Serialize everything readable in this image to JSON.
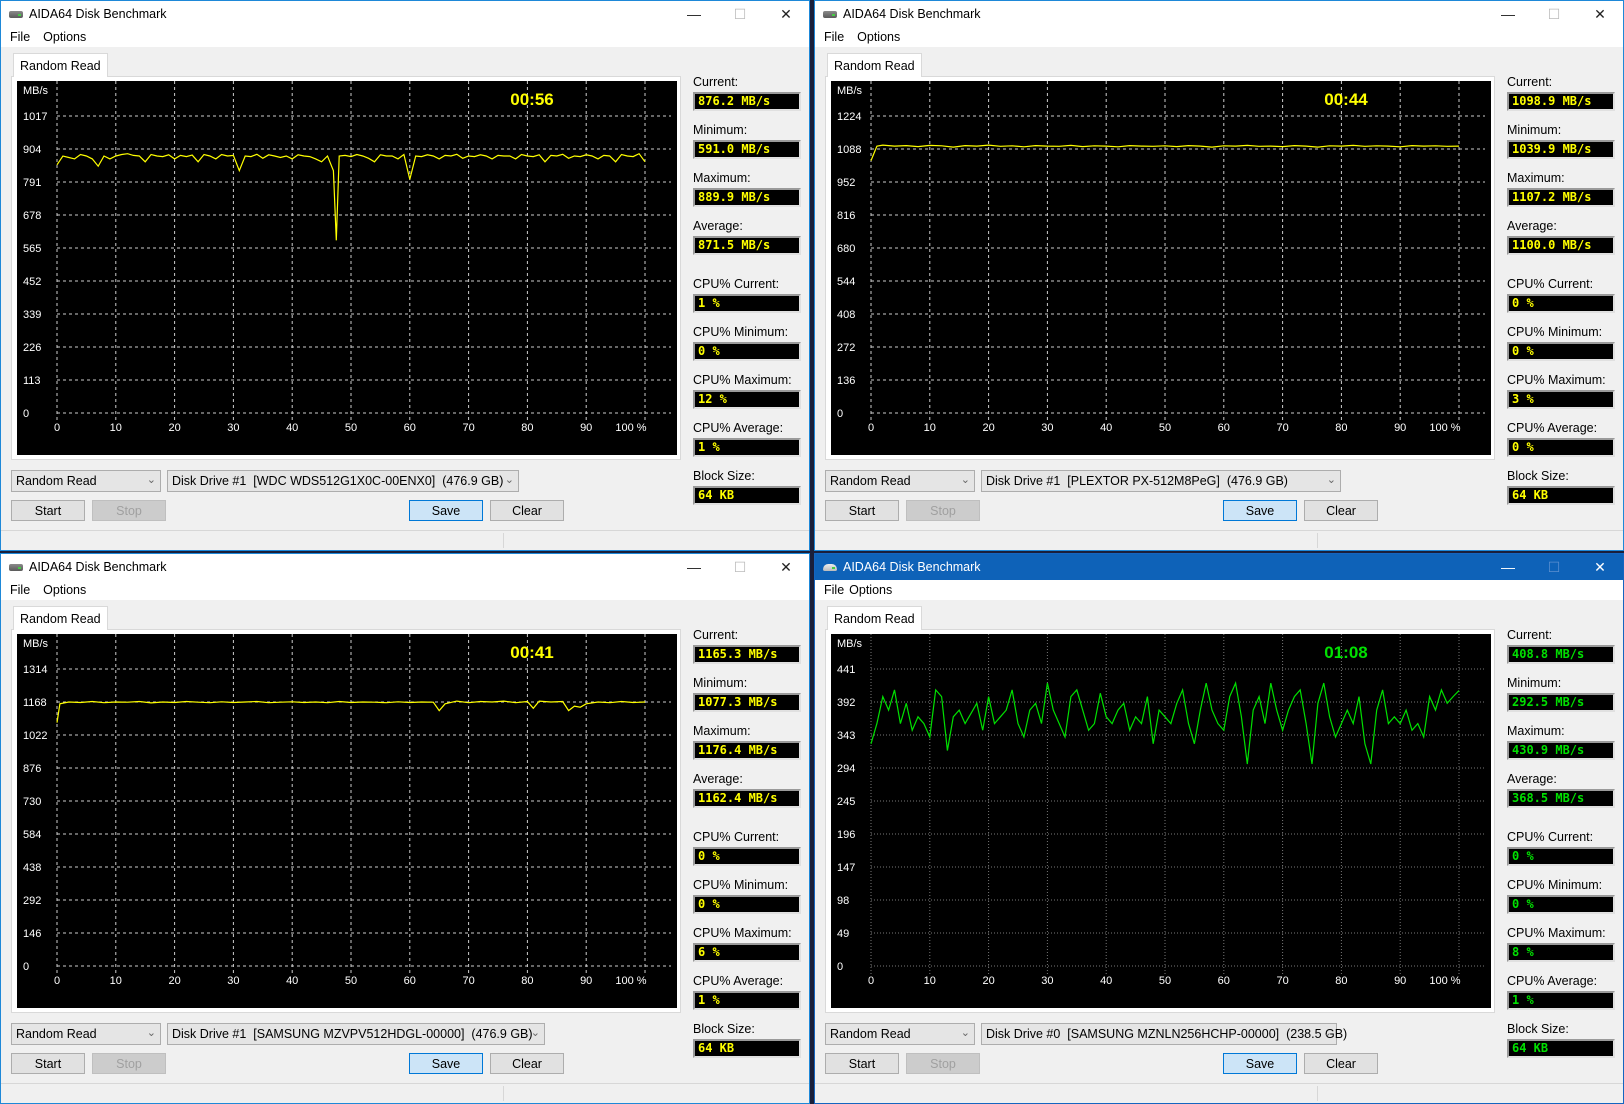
{
  "app_title": "AIDA64 Disk Benchmark",
  "menu": [
    "File",
    "Options"
  ],
  "window_controls": {
    "minimize": "—",
    "maximize": "☐",
    "close": "✕"
  },
  "labels": {
    "tab": "Random Read",
    "current": "Current:",
    "minimum": "Minimum:",
    "maximum": "Maximum:",
    "average": "Average:",
    "cpu_current": "CPU% Current:",
    "cpu_minimum": "CPU% Minimum:",
    "cpu_maximum": "CPU% Maximum:",
    "cpu_average": "CPU% Average:",
    "block_size": "Block Size:",
    "start": "Start",
    "stop": "Stop",
    "save": "Save",
    "clear": "Clear",
    "test_select": "Random Read",
    "y_unit": "MB/s"
  },
  "windows": [
    {
      "active": false,
      "timer": "00:56",
      "drive": "Disk Drive #1  [WDC WDS512G1X0C-00ENX0]  (476.9 GB)",
      "stats": {
        "current": "876.2 MB/s",
        "minimum": "591.0 MB/s",
        "maximum": "889.9 MB/s",
        "average": "871.5 MB/s",
        "cpu_current": "1 %",
        "cpu_minimum": "0 %",
        "cpu_maximum": "12 %",
        "cpu_average": "1 %",
        "block_size": "64 KB"
      },
      "line_color": "#ffff00"
    },
    {
      "active": false,
      "timer": "00:44",
      "drive": "Disk Drive #1  [PLEXTOR PX-512M8PeG]  (476.9 GB)",
      "stats": {
        "current": "1098.9 MB/s",
        "minimum": "1039.9 MB/s",
        "maximum": "1107.2 MB/s",
        "average": "1100.0 MB/s",
        "cpu_current": "0 %",
        "cpu_minimum": "0 %",
        "cpu_maximum": "3 %",
        "cpu_average": "0 %",
        "block_size": "64 KB"
      },
      "line_color": "#ffff00"
    },
    {
      "active": false,
      "timer": "00:41",
      "drive": "Disk Drive #1  [SAMSUNG MZVPV512HDGL-00000]  (476.9 GB)",
      "stats": {
        "current": "1165.3 MB/s",
        "minimum": "1077.3 MB/s",
        "maximum": "1176.4 MB/s",
        "average": "1162.4 MB/s",
        "cpu_current": "0 %",
        "cpu_minimum": "0 %",
        "cpu_maximum": "6 %",
        "cpu_average": "1 %",
        "block_size": "64 KB"
      },
      "line_color": "#ffff00"
    },
    {
      "active": true,
      "timer": "01:08",
      "drive": "Disk Drive #0  [SAMSUNG MZNLN256HCHP-00000]  (238.5 GB)",
      "stats": {
        "current": "408.8 MB/s",
        "minimum": "292.5 MB/s",
        "maximum": "430.9 MB/s",
        "average": "368.5 MB/s",
        "cpu_current": "0 %",
        "cpu_minimum": "0 %",
        "cpu_maximum": "8 %",
        "cpu_average": "1 %",
        "block_size": "64 KB"
      },
      "line_color": "#00e000"
    }
  ],
  "chart_data": [
    {
      "type": "line",
      "title": "Random Read — WDC WDS512G1X0C-00ENX0",
      "ylabel": "MB/s",
      "xlabel": "%",
      "x_ticks": [
        "0",
        "10",
        "20",
        "30",
        "40",
        "50",
        "60",
        "70",
        "80",
        "90",
        "100 %"
      ],
      "y_ticks": [
        0,
        113,
        226,
        339,
        452,
        565,
        678,
        791,
        904,
        1017
      ],
      "ylim": [
        0,
        1130
      ],
      "xlim": [
        0,
        100
      ],
      "grid": true,
      "series": [
        {
          "name": "Random Read",
          "color": "#ffff00",
          "x": [
            0,
            1,
            2,
            3,
            4,
            5,
            6,
            7,
            8,
            9,
            10,
            11,
            12,
            13,
            14,
            15,
            16,
            17,
            18,
            19,
            20,
            21,
            22,
            23,
            24,
            25,
            26,
            27,
            28,
            29,
            30,
            31,
            32,
            33,
            34,
            35,
            36,
            37,
            38,
            39,
            40,
            41,
            42,
            43,
            44,
            45,
            46,
            47,
            47.5,
            48,
            49,
            50,
            51,
            52,
            53,
            54,
            55,
            56,
            57,
            58,
            59,
            60,
            61,
            62,
            63,
            64,
            65,
            66,
            67,
            68,
            69,
            70,
            71,
            72,
            73,
            74,
            75,
            76,
            77,
            78,
            79,
            80,
            81,
            82,
            83,
            84,
            85,
            86,
            87,
            88,
            89,
            90,
            91,
            92,
            93,
            94,
            95,
            96,
            97,
            98,
            99,
            100
          ],
          "y": [
            850,
            880,
            875,
            870,
            885,
            880,
            870,
            845,
            880,
            870,
            880,
            885,
            888,
            882,
            880,
            860,
            885,
            880,
            878,
            884,
            870,
            882,
            878,
            883,
            860,
            885,
            880,
            870,
            885,
            880,
            882,
            830,
            880,
            878,
            886,
            872,
            884,
            880,
            875,
            880,
            870,
            884,
            880,
            878,
            870,
            860,
            880,
            830,
            591,
            880,
            882,
            878,
            885,
            880,
            872,
            860,
            884,
            880,
            880,
            870,
            885,
            800,
            880,
            878,
            884,
            880,
            870,
            882,
            880,
            886,
            872,
            880,
            878,
            884,
            880,
            870,
            882,
            880,
            880,
            870,
            885,
            880,
            878,
            884,
            860,
            882,
            880,
            886,
            872,
            880,
            878,
            884,
            880,
            870,
            882,
            880,
            860,
            885,
            880,
            878,
            888,
            860
          ]
        }
      ]
    },
    {
      "type": "line",
      "title": "Random Read — PLEXTOR PX-512M8PeG",
      "ylabel": "MB/s",
      "xlabel": "%",
      "x_ticks": [
        "0",
        "10",
        "20",
        "30",
        "40",
        "50",
        "60",
        "70",
        "80",
        "90",
        "100 %"
      ],
      "y_ticks": [
        0,
        136,
        272,
        408,
        544,
        680,
        816,
        952,
        1088,
        1224
      ],
      "ylim": [
        0,
        1360
      ],
      "xlim": [
        0,
        100
      ],
      "grid": true,
      "series": [
        {
          "name": "Random Read",
          "color": "#ffff00",
          "x": [
            0,
            1,
            2,
            4,
            6,
            8,
            10,
            12,
            14,
            16,
            18,
            20,
            22,
            24,
            26,
            28,
            30,
            32,
            34,
            36,
            38,
            40,
            42,
            44,
            46,
            48,
            50,
            52,
            54,
            56,
            58,
            60,
            62,
            64,
            66,
            68,
            70,
            72,
            74,
            76,
            78,
            80,
            82,
            84,
            86,
            88,
            90,
            92,
            94,
            96,
            98,
            100
          ],
          "y": [
            1040,
            1100,
            1104,
            1100,
            1102,
            1098,
            1103,
            1101,
            1096,
            1102,
            1100,
            1104,
            1099,
            1101,
            1097,
            1102,
            1100,
            1099,
            1103,
            1098,
            1101,
            1100,
            1097,
            1102,
            1100,
            1099,
            1101,
            1098,
            1102,
            1100,
            1096,
            1101,
            1100,
            1103,
            1099,
            1100,
            1098,
            1102,
            1100,
            1096,
            1101,
            1100,
            1103,
            1099,
            1101,
            1100,
            1097,
            1102,
            1100,
            1101,
            1099,
            1100
          ]
        }
      ]
    },
    {
      "type": "line",
      "title": "Random Read — SAMSUNG MZVPV512HDGL-00000",
      "ylabel": "MB/s",
      "xlabel": "%",
      "x_ticks": [
        "0",
        "10",
        "20",
        "30",
        "40",
        "50",
        "60",
        "70",
        "80",
        "90",
        "100 %"
      ],
      "y_ticks": [
        0,
        146,
        292,
        438,
        584,
        730,
        876,
        1022,
        1168,
        1314
      ],
      "ylim": [
        0,
        1460
      ],
      "xlim": [
        0,
        100
      ],
      "grid": true,
      "series": [
        {
          "name": "Random Read",
          "color": "#ffff00",
          "x": [
            0,
            0.5,
            2,
            4,
            6,
            8,
            10,
            12,
            14,
            16,
            18,
            20,
            22,
            24,
            26,
            28,
            30,
            32,
            34,
            36,
            38,
            40,
            42,
            44,
            46,
            48,
            50,
            52,
            54,
            56,
            58,
            60,
            62,
            64,
            65,
            66,
            68,
            70,
            72,
            74,
            76,
            78,
            80,
            81,
            82,
            84,
            86,
            87,
            88,
            89,
            90,
            92,
            94,
            96,
            98,
            100
          ],
          "y": [
            1077,
            1160,
            1168,
            1166,
            1170,
            1165,
            1168,
            1167,
            1170,
            1164,
            1168,
            1166,
            1170,
            1167,
            1165,
            1169,
            1166,
            1168,
            1170,
            1165,
            1167,
            1169,
            1166,
            1168,
            1165,
            1170,
            1166,
            1168,
            1167,
            1165,
            1169,
            1166,
            1168,
            1167,
            1130,
            1160,
            1172,
            1165,
            1170,
            1168,
            1172,
            1165,
            1170,
            1140,
            1172,
            1168,
            1170,
            1130,
            1150,
            1145,
            1160,
            1168,
            1165,
            1170,
            1166,
            1168
          ]
        }
      ]
    },
    {
      "type": "line",
      "title": "Random Read — SAMSUNG MZNLN256HCHP-00000",
      "ylabel": "MB/s",
      "xlabel": "%",
      "x_ticks": [
        "0",
        "10",
        "20",
        "30",
        "40",
        "50",
        "60",
        "70",
        "80",
        "90",
        "100 %"
      ],
      "y_ticks": [
        0,
        49,
        98,
        147,
        196,
        245,
        294,
        343,
        392,
        441
      ],
      "ylim": [
        0,
        490
      ],
      "xlim": [
        0,
        100
      ],
      "grid": true,
      "series": [
        {
          "name": "Random Read",
          "color": "#00e000",
          "x": [
            0,
            1,
            2,
            3,
            4,
            5,
            6,
            7,
            8,
            9,
            10,
            11,
            12,
            13,
            14,
            15,
            16,
            17,
            18,
            19,
            20,
            21,
            22,
            23,
            24,
            25,
            26,
            27,
            28,
            29,
            30,
            31,
            32,
            33,
            34,
            35,
            36,
            37,
            38,
            39,
            40,
            41,
            42,
            43,
            44,
            45,
            46,
            47,
            48,
            49,
            50,
            51,
            52,
            53,
            54,
            55,
            56,
            57,
            58,
            59,
            60,
            61,
            62,
            63,
            64,
            65,
            66,
            67,
            68,
            69,
            70,
            71,
            72,
            73,
            74,
            75,
            76,
            77,
            78,
            79,
            80,
            81,
            82,
            83,
            84,
            85,
            86,
            87,
            88,
            89,
            90,
            91,
            92,
            93,
            94,
            95,
            96,
            97,
            98,
            99,
            100
          ],
          "y": [
            330,
            360,
            400,
            380,
            410,
            360,
            390,
            350,
            370,
            360,
            340,
            410,
            400,
            320,
            370,
            380,
            360,
            375,
            390,
            350,
            400,
            360,
            370,
            380,
            410,
            360,
            340,
            380,
            390,
            360,
            420,
            380,
            360,
            340,
            400,
            410,
            380,
            350,
            360,
            405,
            370,
            360,
            380,
            390,
            350,
            370,
            360,
            400,
            330,
            380,
            370,
            360,
            390,
            410,
            360,
            330,
            380,
            420,
            380,
            360,
            350,
            400,
            420,
            370,
            300,
            380,
            400,
            360,
            420,
            380,
            350,
            380,
            400,
            410,
            360,
            300,
            390,
            420,
            370,
            340,
            360,
            380,
            360,
            400,
            330,
            300,
            380,
            410,
            360,
            370,
            360,
            380,
            350,
            360,
            340,
            400,
            380,
            410,
            390,
            400,
            409
          ]
        }
      ]
    }
  ]
}
